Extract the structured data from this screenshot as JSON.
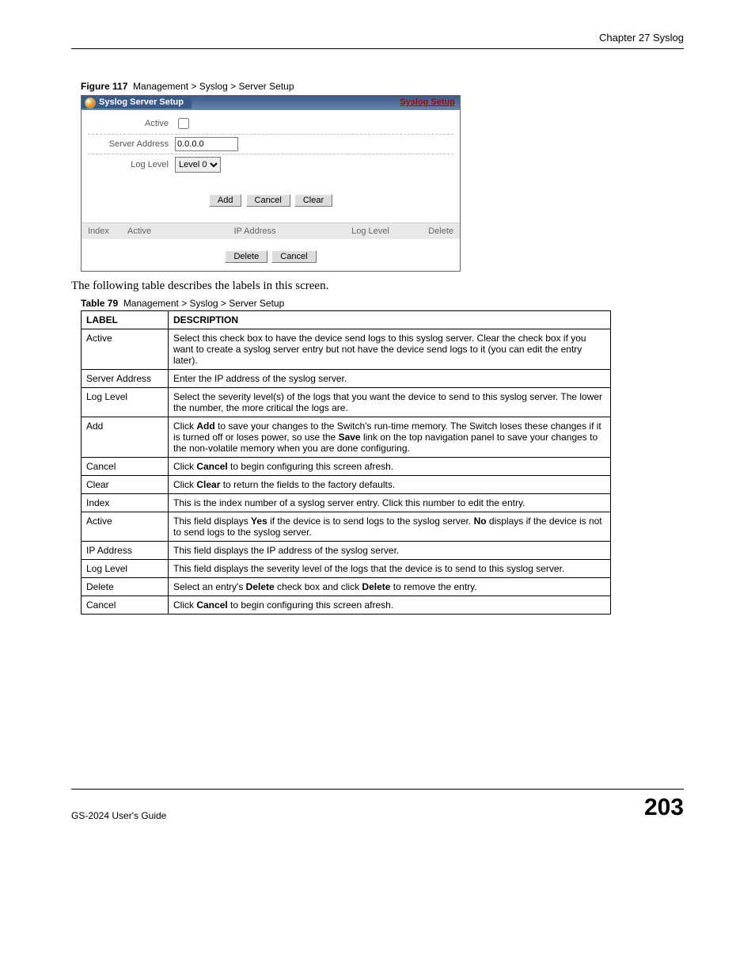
{
  "header": {
    "chapter": "Chapter 27 Syslog"
  },
  "figure": {
    "label": "Figure 117",
    "caption": "Management > Syslog > Server Setup"
  },
  "shot": {
    "title": "Syslog Server Setup",
    "link": "Syslog Setup",
    "rows": {
      "active_label": "Active",
      "server_addr_label": "Server Address",
      "server_addr_value": "0.0.0.0",
      "log_level_label": "Log Level",
      "log_level_value": "Level 0"
    },
    "buttons1": {
      "add": "Add",
      "cancel": "Cancel",
      "clear": "Clear"
    },
    "list_headers": {
      "index": "Index",
      "active": "Active",
      "ip": "IP Address",
      "log": "Log Level",
      "del": "Delete"
    },
    "buttons2": {
      "delete": "Delete",
      "cancel": "Cancel"
    }
  },
  "body_text": "The following table describes the labels in this screen.",
  "table": {
    "label": "Table 79",
    "caption": "Management > Syslog > Server Setup",
    "header": {
      "c1": "LABEL",
      "c2": "DESCRIPTION"
    },
    "rows": [
      {
        "label": "Active",
        "desc_plain": "Select this check box to have the device send logs to this syslog server. Clear the check box if you want to create a syslog server entry but not have the device send logs to it (you can edit the entry later)."
      },
      {
        "label": "Server Address",
        "desc_plain": "Enter the IP address of the syslog server."
      },
      {
        "label": "Log Level",
        "desc_plain": "Select the severity level(s) of the logs that you want the device to send to this syslog server. The lower the number, the more critical the logs are."
      },
      {
        "label": "Add",
        "desc_html": "Click <b>Add</b> to save your changes to the Switch's run-time memory. The Switch loses these changes if it is turned off or loses power, so use the <b>Save</b> link on the top navigation panel to save your changes to the non-volatile memory when you are done configuring."
      },
      {
        "label": "Cancel",
        "desc_html": "Click <b>Cancel</b> to begin configuring this screen afresh."
      },
      {
        "label": "Clear",
        "desc_html": "Click <b>Clear</b> to return the fields to the factory defaults."
      },
      {
        "label": "Index",
        "desc_plain": "This is the index number of a syslog server entry. Click this number to edit the entry."
      },
      {
        "label": "Active",
        "desc_html": "This field displays <b>Yes</b> if the device is to send logs to the syslog server. <b>No</b> displays if the device is not to send logs to the syslog server."
      },
      {
        "label": "IP Address",
        "desc_plain": "This field displays the IP address of the syslog server."
      },
      {
        "label": "Log Level",
        "desc_plain": "This field displays the severity level of the logs that the device is to send to this syslog server."
      },
      {
        "label": "Delete",
        "desc_html": "Select an entry's <b>Delete</b> check box and click <b>Delete</b> to remove the entry."
      },
      {
        "label": "Cancel",
        "desc_html": "Click <b>Cancel</b> to begin configuring this screen afresh."
      }
    ]
  },
  "footer": {
    "guide": "GS-2024 User's Guide",
    "page": "203"
  }
}
